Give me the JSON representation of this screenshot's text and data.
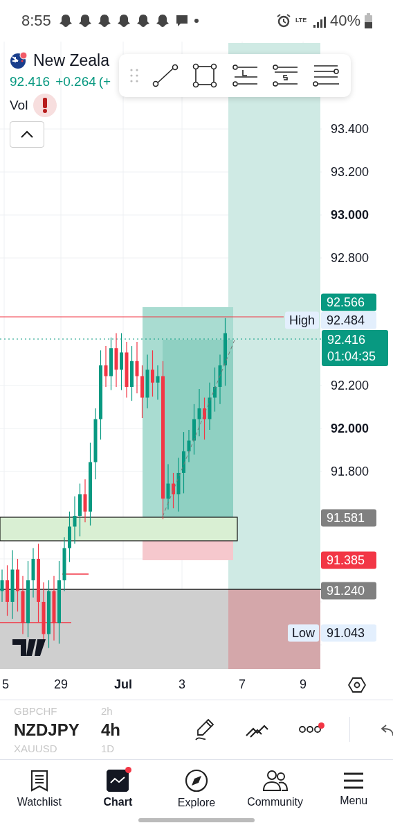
{
  "status_bar": {
    "time": "8:55",
    "network": "LTE",
    "battery": "40%"
  },
  "chart": {
    "symbol_name": "New Zeala",
    "price": "92.416",
    "change": "+0.264",
    "change_percent": "(+",
    "indicator": "Vol",
    "price_axis": [
      {
        "label": "93.400",
        "major": false
      },
      {
        "label": "93.200",
        "major": false
      },
      {
        "label": "93.000",
        "major": true
      },
      {
        "label": "92.800",
        "major": false
      },
      {
        "label": "92.200",
        "major": false
      },
      {
        "label": "92.000",
        "major": true
      },
      {
        "label": "91.800",
        "major": false
      }
    ],
    "price_tags": [
      {
        "kind": "plain",
        "value": "92.566",
        "color": "#089981"
      },
      {
        "kind": "labeled",
        "label": "High",
        "value": "92.484"
      },
      {
        "kind": "current",
        "value": "92.416",
        "countdown": "01:04:35",
        "color": "#089981"
      },
      {
        "kind": "plain",
        "value": "91.581",
        "color": "#808080"
      },
      {
        "kind": "plain",
        "value": "91.385",
        "color": "#f23645"
      },
      {
        "kind": "plain",
        "value": "91.240",
        "color": "#808080"
      },
      {
        "kind": "labeled",
        "label": "Low",
        "value": "91.043"
      }
    ],
    "time_axis": [
      {
        "label": "5",
        "major": false
      },
      {
        "label": "29",
        "major": false
      },
      {
        "label": "Jul",
        "major": true
      },
      {
        "label": "3",
        "major": false
      },
      {
        "label": "7",
        "major": false
      },
      {
        "label": "9",
        "major": false
      }
    ]
  },
  "symbols": [
    {
      "symbol": "GBPCHF",
      "interval": "2h",
      "selected": false
    },
    {
      "symbol": "NZDJPY",
      "interval": "4h",
      "selected": true
    },
    {
      "symbol": "XAUUSD",
      "interval": "1D",
      "selected": false
    }
  ],
  "more_notification": true,
  "nav": [
    {
      "label": "Watchlist",
      "selected": false,
      "notification": false
    },
    {
      "label": "Chart",
      "selected": true,
      "notification": true
    },
    {
      "label": "Explore",
      "selected": false,
      "notification": false
    },
    {
      "label": "Community",
      "selected": false,
      "notification": false
    },
    {
      "label": "Menu",
      "selected": false,
      "notification": false
    }
  ]
}
